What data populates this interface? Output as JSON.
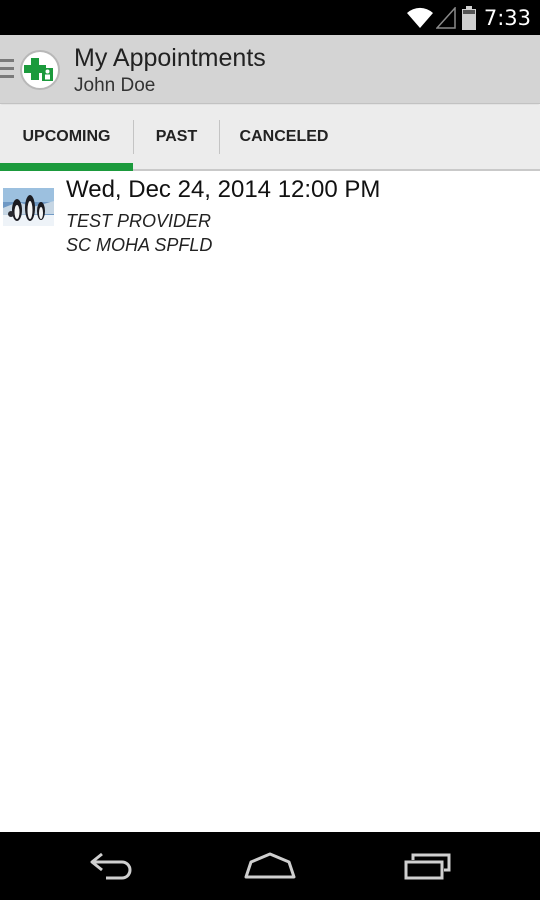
{
  "status_bar": {
    "time": "7:33",
    "icons": [
      "wifi-icon",
      "signal-icon",
      "battery-icon"
    ]
  },
  "action_bar": {
    "title": "My Appointments",
    "subtitle": "John Doe",
    "logo_icon": "medical-cross-logo-icon",
    "accent_color": "#1b9a3c"
  },
  "tabs": [
    {
      "label": "UPCOMING",
      "selected": true
    },
    {
      "label": "PAST",
      "selected": false
    },
    {
      "label": "CANCELED",
      "selected": false
    }
  ],
  "appointments": [
    {
      "thumbnail_icon": "penguins-photo",
      "datetime": "Wed, Dec 24, 2014 12:00 PM",
      "provider": "TEST PROVIDER",
      "location": "SC MOHA SPFLD"
    }
  ],
  "nav_bar": {
    "buttons": [
      "back-icon",
      "home-icon",
      "recents-icon"
    ]
  }
}
